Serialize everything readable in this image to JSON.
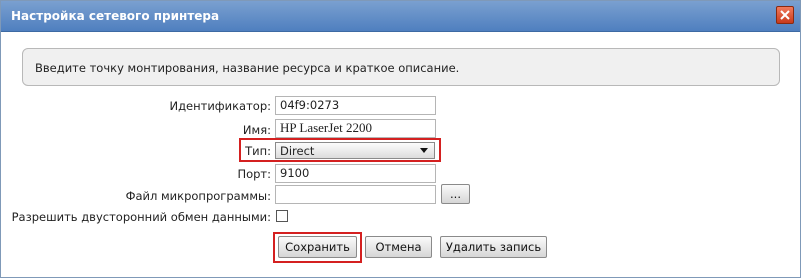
{
  "dialog": {
    "title": "Настройка сетевого принтера",
    "info_text": "Введите точку монтирования, название ресурса и краткое описание."
  },
  "form": {
    "identifier": {
      "label": "Идентификатор:",
      "value": "04f9:0273"
    },
    "name": {
      "label": "Имя:",
      "value": "HP LaserJet 2200"
    },
    "type": {
      "label": "Тип:",
      "selected": "Direct"
    },
    "port": {
      "label": "Порт:",
      "value": "9100"
    },
    "firmware": {
      "label": "Файл микропрограммы:",
      "value": "",
      "browse_label": "..."
    },
    "bidirectional": {
      "label": "Разрешить двусторонний обмен данными:",
      "checked": false
    }
  },
  "buttons": {
    "save": "Сохранить",
    "cancel": "Отмена",
    "delete": "Удалить запись"
  },
  "colors": {
    "titlebar": "#5f8cc8",
    "highlight": "#d42020",
    "close": "#d84a2a"
  },
  "icons": {
    "close": "close-icon",
    "dropdown": "chevron-down-icon"
  }
}
